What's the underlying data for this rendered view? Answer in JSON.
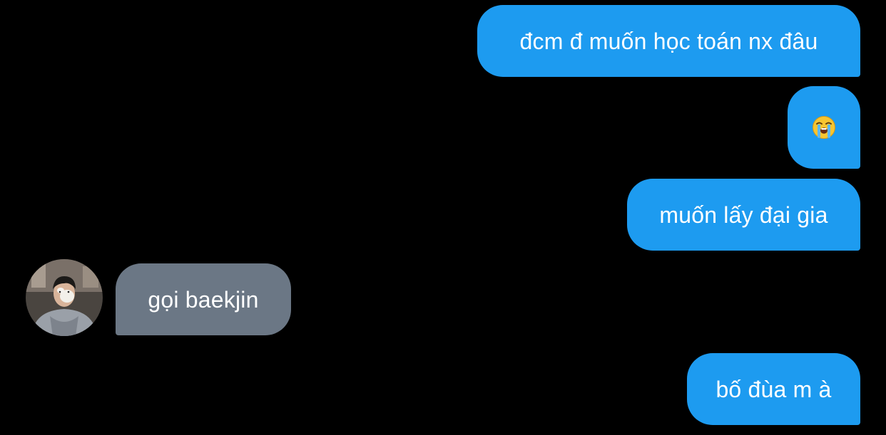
{
  "conversation": {
    "messages": [
      {
        "direction": "outgoing",
        "text": "đcm đ muốn học toán nx đâu"
      },
      {
        "direction": "outgoing",
        "emoji": "loudly-crying-face"
      },
      {
        "direction": "outgoing",
        "text": "muốn lấy đại gia"
      },
      {
        "direction": "incoming",
        "text": "gọi baekjin"
      },
      {
        "direction": "outgoing",
        "text": "bố đùa m à"
      }
    ]
  },
  "colors": {
    "background": "#000000",
    "outgoing_bubble": "#1d9bf0",
    "incoming_bubble": "#6b7785",
    "text": "#ffffff"
  }
}
